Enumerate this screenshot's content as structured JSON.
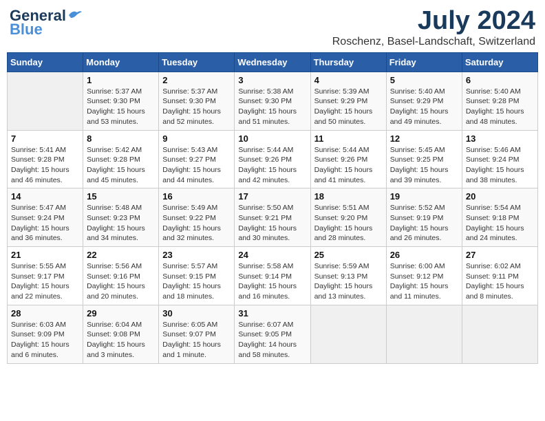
{
  "logo": {
    "line1": "General",
    "line2": "Blue"
  },
  "title": "July 2024",
  "location": "Roschenz, Basel-Landschaft, Switzerland",
  "weekdays": [
    "Sunday",
    "Monday",
    "Tuesday",
    "Wednesday",
    "Thursday",
    "Friday",
    "Saturday"
  ],
  "weeks": [
    [
      {
        "num": "",
        "info": ""
      },
      {
        "num": "1",
        "info": "Sunrise: 5:37 AM\nSunset: 9:30 PM\nDaylight: 15 hours\nand 53 minutes."
      },
      {
        "num": "2",
        "info": "Sunrise: 5:37 AM\nSunset: 9:30 PM\nDaylight: 15 hours\nand 52 minutes."
      },
      {
        "num": "3",
        "info": "Sunrise: 5:38 AM\nSunset: 9:30 PM\nDaylight: 15 hours\nand 51 minutes."
      },
      {
        "num": "4",
        "info": "Sunrise: 5:39 AM\nSunset: 9:29 PM\nDaylight: 15 hours\nand 50 minutes."
      },
      {
        "num": "5",
        "info": "Sunrise: 5:40 AM\nSunset: 9:29 PM\nDaylight: 15 hours\nand 49 minutes."
      },
      {
        "num": "6",
        "info": "Sunrise: 5:40 AM\nSunset: 9:28 PM\nDaylight: 15 hours\nand 48 minutes."
      }
    ],
    [
      {
        "num": "7",
        "info": "Sunrise: 5:41 AM\nSunset: 9:28 PM\nDaylight: 15 hours\nand 46 minutes."
      },
      {
        "num": "8",
        "info": "Sunrise: 5:42 AM\nSunset: 9:28 PM\nDaylight: 15 hours\nand 45 minutes."
      },
      {
        "num": "9",
        "info": "Sunrise: 5:43 AM\nSunset: 9:27 PM\nDaylight: 15 hours\nand 44 minutes."
      },
      {
        "num": "10",
        "info": "Sunrise: 5:44 AM\nSunset: 9:26 PM\nDaylight: 15 hours\nand 42 minutes."
      },
      {
        "num": "11",
        "info": "Sunrise: 5:44 AM\nSunset: 9:26 PM\nDaylight: 15 hours\nand 41 minutes."
      },
      {
        "num": "12",
        "info": "Sunrise: 5:45 AM\nSunset: 9:25 PM\nDaylight: 15 hours\nand 39 minutes."
      },
      {
        "num": "13",
        "info": "Sunrise: 5:46 AM\nSunset: 9:24 PM\nDaylight: 15 hours\nand 38 minutes."
      }
    ],
    [
      {
        "num": "14",
        "info": "Sunrise: 5:47 AM\nSunset: 9:24 PM\nDaylight: 15 hours\nand 36 minutes."
      },
      {
        "num": "15",
        "info": "Sunrise: 5:48 AM\nSunset: 9:23 PM\nDaylight: 15 hours\nand 34 minutes."
      },
      {
        "num": "16",
        "info": "Sunrise: 5:49 AM\nSunset: 9:22 PM\nDaylight: 15 hours\nand 32 minutes."
      },
      {
        "num": "17",
        "info": "Sunrise: 5:50 AM\nSunset: 9:21 PM\nDaylight: 15 hours\nand 30 minutes."
      },
      {
        "num": "18",
        "info": "Sunrise: 5:51 AM\nSunset: 9:20 PM\nDaylight: 15 hours\nand 28 minutes."
      },
      {
        "num": "19",
        "info": "Sunrise: 5:52 AM\nSunset: 9:19 PM\nDaylight: 15 hours\nand 26 minutes."
      },
      {
        "num": "20",
        "info": "Sunrise: 5:54 AM\nSunset: 9:18 PM\nDaylight: 15 hours\nand 24 minutes."
      }
    ],
    [
      {
        "num": "21",
        "info": "Sunrise: 5:55 AM\nSunset: 9:17 PM\nDaylight: 15 hours\nand 22 minutes."
      },
      {
        "num": "22",
        "info": "Sunrise: 5:56 AM\nSunset: 9:16 PM\nDaylight: 15 hours\nand 20 minutes."
      },
      {
        "num": "23",
        "info": "Sunrise: 5:57 AM\nSunset: 9:15 PM\nDaylight: 15 hours\nand 18 minutes."
      },
      {
        "num": "24",
        "info": "Sunrise: 5:58 AM\nSunset: 9:14 PM\nDaylight: 15 hours\nand 16 minutes."
      },
      {
        "num": "25",
        "info": "Sunrise: 5:59 AM\nSunset: 9:13 PM\nDaylight: 15 hours\nand 13 minutes."
      },
      {
        "num": "26",
        "info": "Sunrise: 6:00 AM\nSunset: 9:12 PM\nDaylight: 15 hours\nand 11 minutes."
      },
      {
        "num": "27",
        "info": "Sunrise: 6:02 AM\nSunset: 9:11 PM\nDaylight: 15 hours\nand 8 minutes."
      }
    ],
    [
      {
        "num": "28",
        "info": "Sunrise: 6:03 AM\nSunset: 9:09 PM\nDaylight: 15 hours\nand 6 minutes."
      },
      {
        "num": "29",
        "info": "Sunrise: 6:04 AM\nSunset: 9:08 PM\nDaylight: 15 hours\nand 3 minutes."
      },
      {
        "num": "30",
        "info": "Sunrise: 6:05 AM\nSunset: 9:07 PM\nDaylight: 15 hours\nand 1 minute."
      },
      {
        "num": "31",
        "info": "Sunrise: 6:07 AM\nSunset: 9:05 PM\nDaylight: 14 hours\nand 58 minutes."
      },
      {
        "num": "",
        "info": ""
      },
      {
        "num": "",
        "info": ""
      },
      {
        "num": "",
        "info": ""
      }
    ]
  ]
}
